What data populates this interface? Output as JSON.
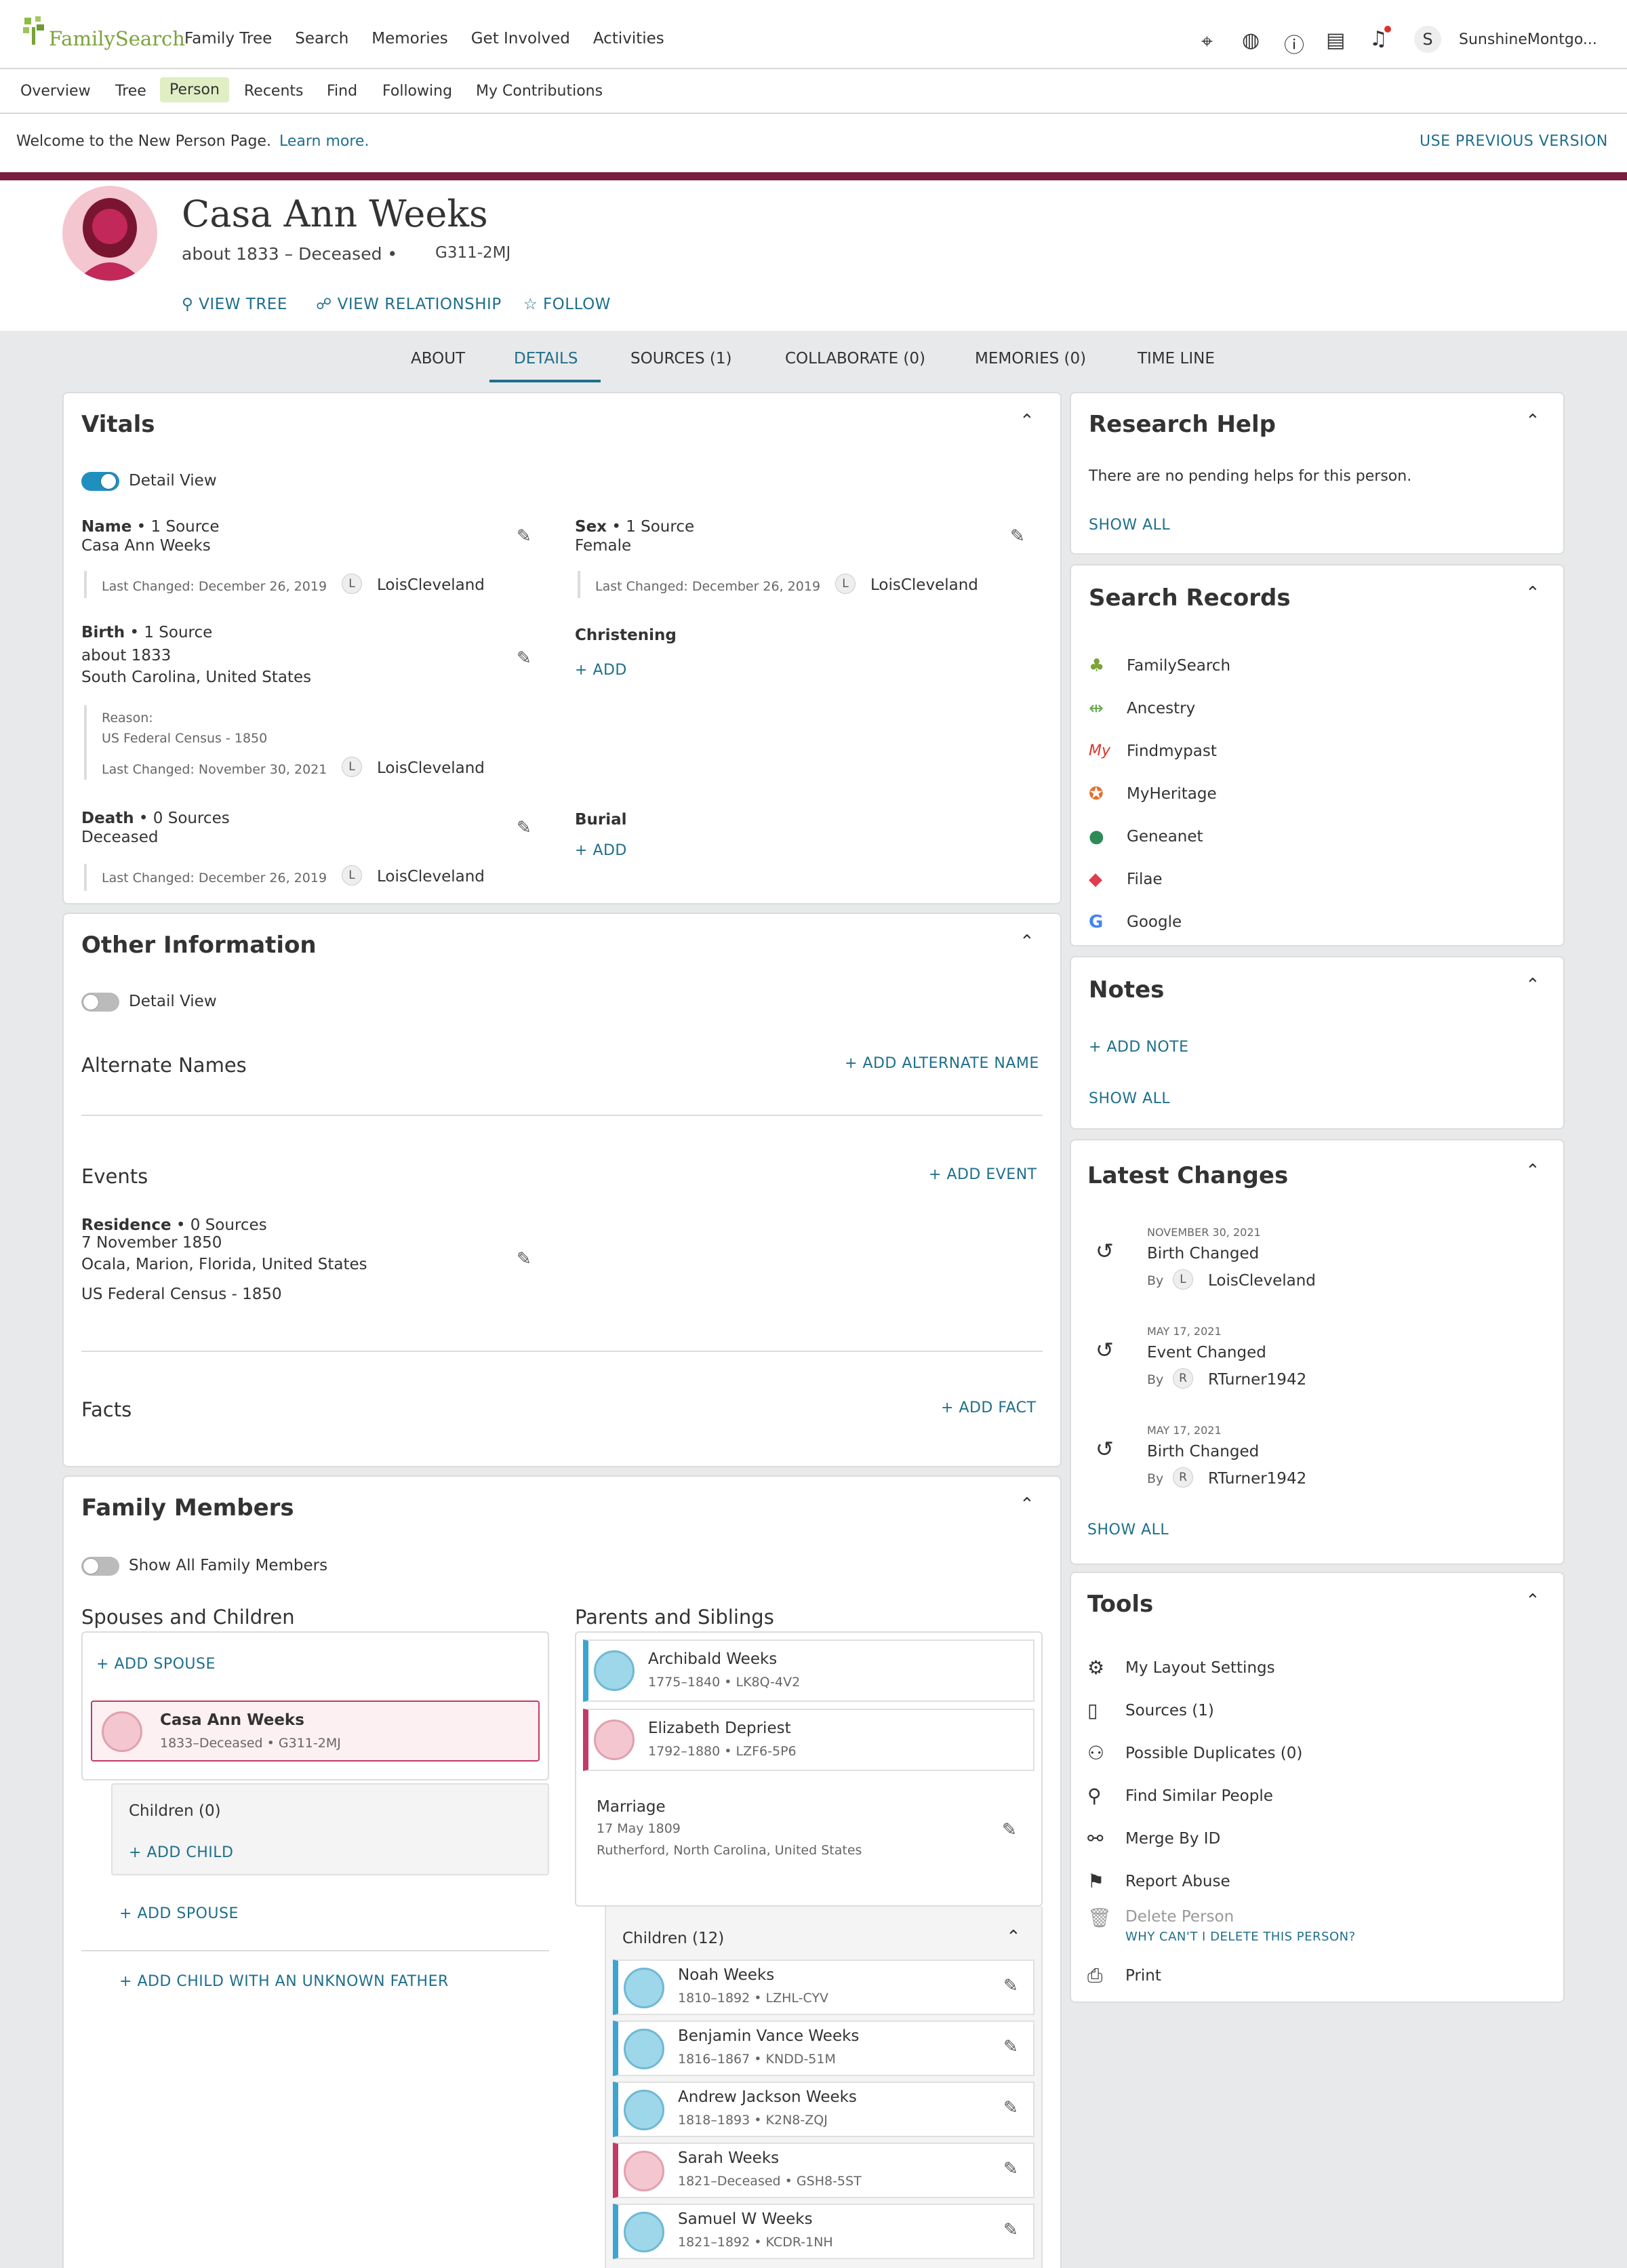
{
  "brand": "FamilySearch",
  "topnav": [
    "Family Tree",
    "Search",
    "Memories",
    "Get Involved",
    "Activities"
  ],
  "user": {
    "initial": "S",
    "name": "SunshineMontgo..."
  },
  "subnav": [
    "Overview",
    "Tree",
    "Person",
    "Recents",
    "Find",
    "Following",
    "My Contributions"
  ],
  "welcome": {
    "text": "Welcome to the New Person Page.",
    "link": "Learn more.",
    "right": "USE PREVIOUS VERSION"
  },
  "person": {
    "name": "Casa Ann Weeks",
    "meta": "about 1833 – Deceased •",
    "pid": "G311-2MJ",
    "actions": [
      "VIEW TREE",
      "VIEW RELATIONSHIP",
      "FOLLOW"
    ]
  },
  "tabs": [
    "ABOUT",
    "DETAILS",
    "SOURCES (1)",
    "COLLABORATE (0)",
    "MEMORIES (0)",
    "TIME LINE"
  ],
  "vitals": {
    "title": "Vitals",
    "detail_view": "Detail View",
    "name": {
      "label": "Name",
      "src": "• 1 Source",
      "value": "Casa Ann Weeks",
      "changed": "Last Changed: December 26, 2019",
      "init": "L",
      "user": "LoisCleveland"
    },
    "sex": {
      "label": "Sex",
      "src": "• 1 Source",
      "value": "Female",
      "changed": "Last Changed: December 26, 2019",
      "init": "L",
      "user": "LoisCleveland"
    },
    "birth": {
      "label": "Birth",
      "src": "• 1 Source",
      "v1": "about 1833",
      "v2": "South Carolina, United States",
      "reason_label": "Reason:",
      "reason": "US Federal Census - 1850",
      "changed": "Last Changed: November 30, 2021",
      "init": "L",
      "user": "LoisCleveland"
    },
    "christening": {
      "label": "Christening",
      "add": "ADD"
    },
    "death": {
      "label": "Death",
      "src": "• 0 Sources",
      "value": "Deceased",
      "changed": "Last Changed: December 26, 2019",
      "init": "L",
      "user": "LoisCleveland"
    },
    "burial": {
      "label": "Burial",
      "add": "ADD"
    }
  },
  "other": {
    "title": "Other Information",
    "detail_view": "Detail View",
    "alt_names": "Alternate Names",
    "add_alt": "ADD ALTERNATE NAME",
    "events": "Events",
    "add_event": "ADD EVENT",
    "residence": {
      "label": "Residence",
      "src": "• 0 Sources",
      "d": "7 November 1850",
      "p": "Ocala, Marion, Florida, United States",
      "r": "US Federal Census - 1850"
    },
    "facts": "Facts",
    "add_fact": "ADD FACT"
  },
  "family": {
    "title": "Family Members",
    "show_all": "Show All Family Members",
    "spouses_title": "Spouses and Children",
    "parents_title": "Parents and Siblings",
    "add_spouse": "ADD SPOUSE",
    "self": {
      "name": "Casa Ann Weeks",
      "dates": "1833–Deceased •",
      "pid": "G311-2MJ"
    },
    "children": "Children (0)",
    "add_child": "ADD CHILD",
    "add_spouse2": "ADD SPOUSE",
    "add_child_unknown": "ADD CHILD WITH AN UNKNOWN FATHER",
    "father": {
      "name": "Archibald Weeks",
      "dates": "1775–1840 •",
      "pid": "LK8Q-4V2"
    },
    "mother": {
      "name": "Elizabeth Depriest",
      "dates": "1792–1880 •",
      "pid": "LZF6-5P6"
    },
    "marriage": {
      "label": "Marriage",
      "d": "17 May 1809",
      "p": "Rutherford, North Carolina, United States"
    },
    "siblings_title": "Children (12)",
    "siblings": [
      {
        "name": "Noah Weeks",
        "dates": "1810–1892 •",
        "pid": "LZHL-CYV",
        "sex": "m"
      },
      {
        "name": "Benjamin Vance Weeks",
        "dates": "1816–1867 •",
        "pid": "KNDD-51M",
        "sex": "m"
      },
      {
        "name": "Andrew Jackson Weeks",
        "dates": "1818–1893 •",
        "pid": "K2N8-ZQJ",
        "sex": "m"
      },
      {
        "name": "Sarah Weeks",
        "dates": "1821–Deceased •",
        "pid": "GSH8-5ST",
        "sex": "f"
      },
      {
        "name": "Samuel W Weeks",
        "dates": "1821–1892 •",
        "pid": "KCDR-1NH",
        "sex": "m"
      }
    ]
  },
  "research": {
    "title": "Research Help",
    "text": "There are no pending helps for this person.",
    "show_all": "SHOW ALL"
  },
  "search_records": {
    "title": "Search Records",
    "items": [
      "FamilySearch",
      "Ancestry",
      "Findmypast",
      "MyHeritage",
      "Geneanet",
      "Filae",
      "Google"
    ]
  },
  "notes": {
    "title": "Notes",
    "add": "ADD NOTE",
    "show_all": "SHOW ALL"
  },
  "latest": {
    "title": "Latest Changes",
    "by": "By",
    "show_all": "SHOW ALL",
    "items": [
      {
        "date": "NOVEMBER 30, 2021",
        "what": "Birth Changed",
        "init": "L",
        "user": "LoisCleveland"
      },
      {
        "date": "MAY 17, 2021",
        "what": "Event Changed",
        "init": "R",
        "user": "RTurner1942"
      },
      {
        "date": "MAY 17, 2021",
        "what": "Birth Changed",
        "init": "R",
        "user": "RTurner1942"
      }
    ]
  },
  "tools": {
    "title": "Tools",
    "items": [
      "My Layout Settings",
      "Sources (1)",
      "Possible Duplicates (0)",
      "Find Similar People",
      "Merge By ID",
      "Report Abuse"
    ],
    "delete": "Delete Person",
    "delete_why": "WHY CAN'T I DELETE THIS PERSON?",
    "print": "Print"
  },
  "colors": {
    "accent": "#1f6f8b",
    "maroon": "#7a1f3d",
    "person_tab_bg": "#dfeec3"
  }
}
